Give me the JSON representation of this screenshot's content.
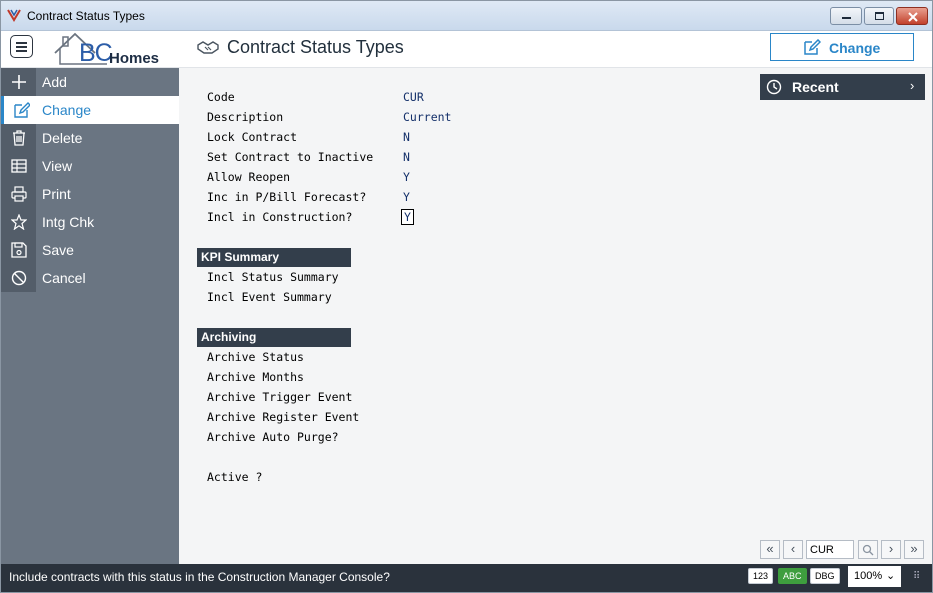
{
  "window": {
    "title": "Contract Status Types"
  },
  "header": {
    "logo_bc": "BC",
    "logo_homes": "Homes",
    "page_title": "Contract Status Types",
    "change_label": "Change"
  },
  "sidebar": {
    "items": [
      {
        "label": "Add",
        "icon": "plus-icon"
      },
      {
        "label": "Change",
        "icon": "edit-icon"
      },
      {
        "label": "Delete",
        "icon": "trash-icon"
      },
      {
        "label": "View",
        "icon": "table-icon"
      },
      {
        "label": "Print",
        "icon": "printer-icon"
      },
      {
        "label": "Intg Chk",
        "icon": "star-icon"
      },
      {
        "label": "Save",
        "icon": "save-icon"
      },
      {
        "label": "Cancel",
        "icon": "cancel-icon"
      }
    ],
    "active_index": 1
  },
  "form": {
    "fields": [
      {
        "label": "Code",
        "value": "CUR"
      },
      {
        "label": "Description",
        "value": "Current"
      },
      {
        "label": "Lock Contract",
        "value": "N"
      },
      {
        "label": "Set Contract to Inactive",
        "value": "N"
      },
      {
        "label": "Allow Reopen",
        "value": "Y"
      },
      {
        "label": "Inc in P/Bill Forecast?",
        "value": "Y"
      },
      {
        "label": "Incl in Construction?",
        "value": "Y"
      }
    ],
    "kpi_title": "KPI Summary",
    "kpi_fields": [
      {
        "label": "Incl Status Summary"
      },
      {
        "label": "Incl Event Summary"
      }
    ],
    "archiving_title": "Archiving",
    "archiving_fields": [
      {
        "label": "Archive Status"
      },
      {
        "label": "Archive Months"
      },
      {
        "label": "Archive Trigger Event"
      },
      {
        "label": "Archive Register Event"
      },
      {
        "label": "Archive Auto Purge?"
      }
    ],
    "active_label": "Active ?"
  },
  "recent": {
    "label": "Recent"
  },
  "navigator": {
    "value": "CUR"
  },
  "statusbar": {
    "message": "Include contracts with this status in the Construction Manager Console?",
    "badge_num": "123",
    "badge_abc": "ABC",
    "badge_dbg": "DBG",
    "zoom": "100%"
  },
  "colors": {
    "accent": "#2a86c8",
    "sidebar": "#6a7582",
    "dark": "#333e4b"
  }
}
